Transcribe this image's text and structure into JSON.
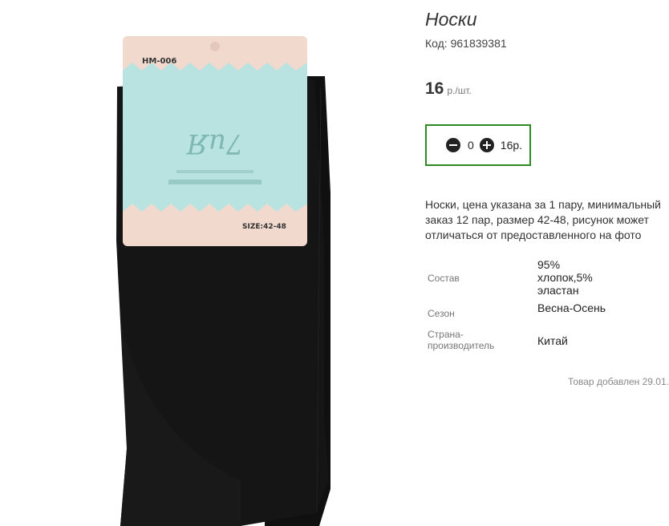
{
  "product": {
    "title": "Носки",
    "code": "Код: 961839381",
    "price_value": "16",
    "price_unit": "р./шт.",
    "quantity": "0",
    "sum": "16р.",
    "description": "Носки, цена указана за 1 пару, минимальный заказ 12 пар, размер 42-48, рисунок может отличаться от предоставленного на фото",
    "added": "Товар добавлен 29.01."
  },
  "properties": [
    {
      "label": "Состав",
      "value": "95% хлопок,5% эластан"
    },
    {
      "label": "Сезон",
      "value": "Весна-Осень"
    },
    {
      "label": "Страна-производитель",
      "value": "Китай"
    }
  ],
  "photo": {
    "tag_model": "HM-006",
    "tag_size": "SIZE:42-48",
    "brand": "7иЯ"
  },
  "colors": {
    "qty_border": "#2e8b23",
    "sock": "#141414",
    "tag_pink": "#f2d9cd",
    "tag_teal": "#b9e3e0"
  }
}
